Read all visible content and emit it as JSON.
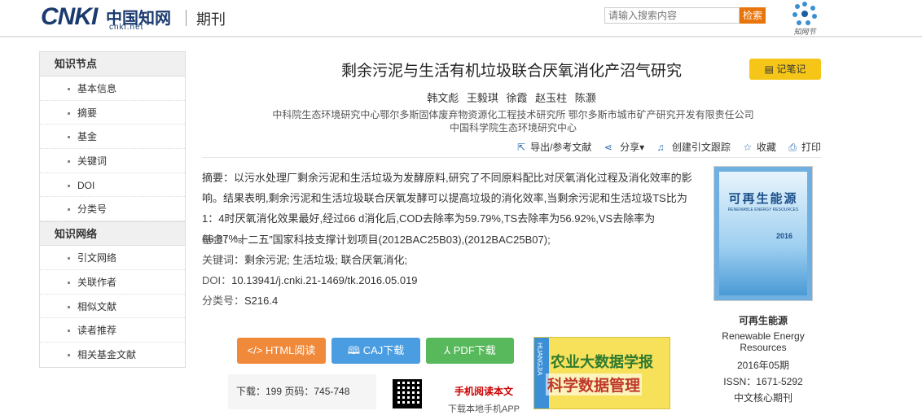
{
  "header": {
    "logo_text": "CNKI",
    "logo_cn": "中国知网",
    "logo_url": "cnki.net",
    "section": "期刊",
    "search_placeholder": "请输入搜索内容",
    "search_button": "检索",
    "zwb_label": "知网节"
  },
  "sidebar": {
    "groups": [
      {
        "title": "知识节点",
        "items": [
          "基本信息",
          "摘要",
          "基金",
          "关键词",
          "DOI",
          "分类号"
        ]
      },
      {
        "title": "知识网络",
        "items": [
          "引文网络",
          "关联作者",
          "相似文献",
          "读者推荐",
          "相关基金文献"
        ]
      }
    ]
  },
  "article": {
    "title": "剩余污泥与生活有机垃圾联合厌氧消化产沼气研究",
    "note_button": "记笔记",
    "authors": "韩文彪  王毅琪  徐霞  赵玉柱  陈灏",
    "orgs": "中科院生态环境研究中心鄂尔多斯固体废弃物资源化工程技术研究所   鄂尔多斯市城市矿产研究开发有限责任公司   中国科学院生态环境研究中心",
    "actions": {
      "export": "导出/参考文献",
      "share": "分享",
      "trace": "创建引文跟踪",
      "favorite": "收藏",
      "print": "打印"
    },
    "abstract_label": "摘要：",
    "abstract": "以污水处理厂剩余污泥和生活垃圾为发酵原料,研究了不同原料配比对厌氧消化过程及消化效率的影响。结果表明,剩余污泥和生活垃圾联合厌氧发酵可以提高垃圾的消化效率,当剩余污泥和生活垃圾TS比为1：4时厌氧消化效果最好,经过66 d消化后,COD去除率为59.79%,TS去除率为56.92%,VS去除率为66.87%。",
    "fund_label": "基金：",
    "fund": "“十二五”国家科技支撑计划项目(2012BAC25B03),(2012BAC25B07);",
    "keywords_label": "关键词：",
    "keywords": "剩余污泥; 生活垃圾; 联合厌氧消化;",
    "doi_label": "DOI：",
    "doi": "10.13941/j.cnki.21-1469/tk.2016.05.019",
    "class_label": "分类号：",
    "class": "S216.4"
  },
  "downloads": {
    "html": "HTML阅读",
    "caj": "CAJ下载",
    "pdf": "PDF下载",
    "stats": "下载：199  页码：745-748",
    "mobile_read": "手机阅读本文",
    "mobile_sub": "下载本地手机APP"
  },
  "journal": {
    "cover_title": "可再生能源",
    "cover_sub": "RENEWABLE ENERGY RESOURCES",
    "cover_year": "2016",
    "name": "可再生能源",
    "eng": "Renewable Energy Resources",
    "date": "2016年05期",
    "issn": "ISSN：1671-5292",
    "core": "中文核心期刊"
  },
  "ad": {
    "line1": "农业大数据学报",
    "line2": "科学数据管理",
    "tag": "HUANGJIA"
  },
  "colors": {
    "accent_orange": "#f0893a",
    "accent_blue": "#4a9de0",
    "accent_green": "#57b95b",
    "note_yellow": "#f5c518"
  }
}
